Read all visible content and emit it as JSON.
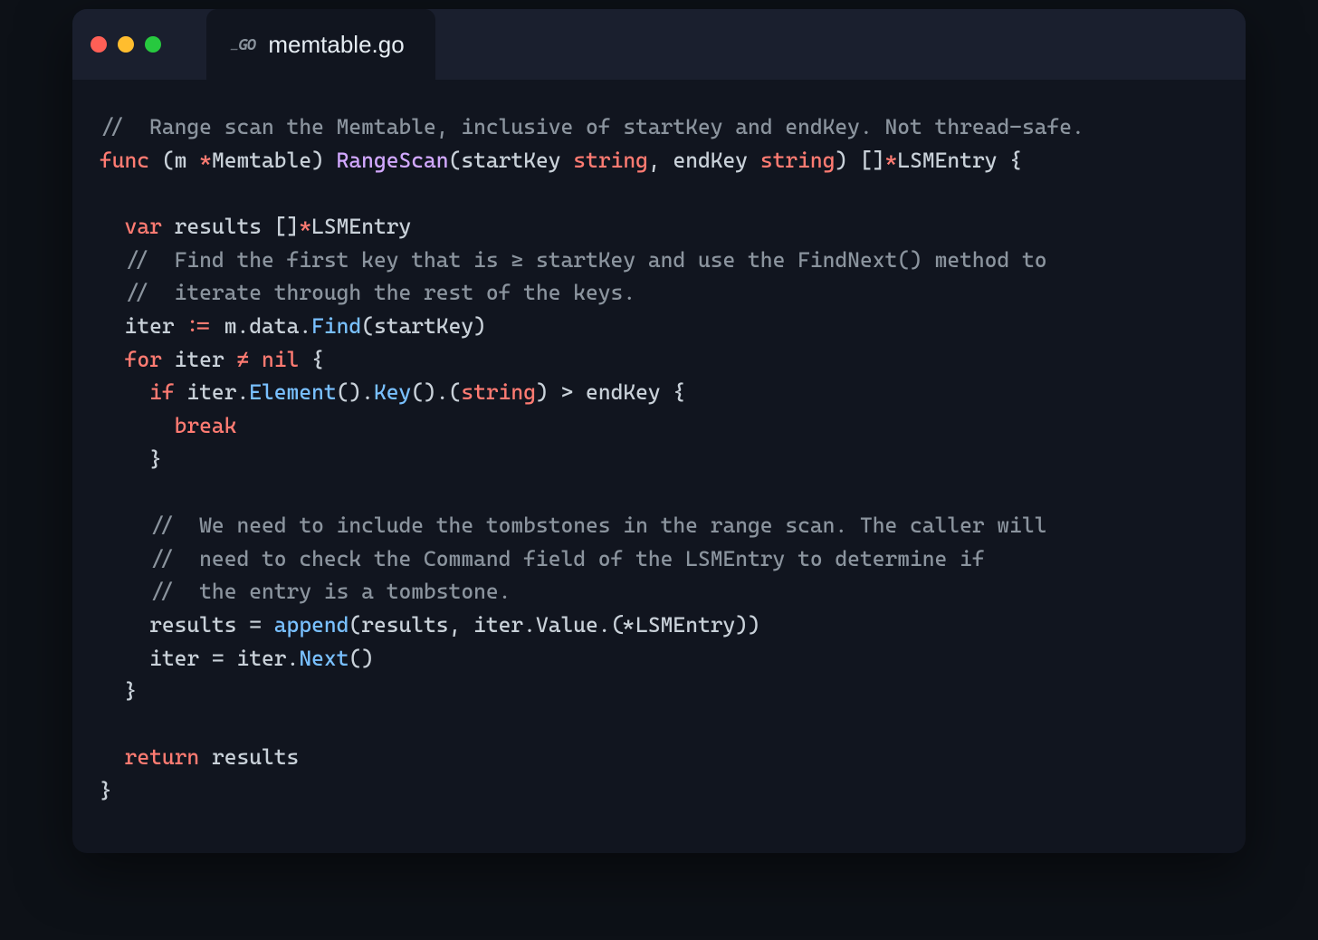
{
  "tab": {
    "filename": "memtable.go",
    "language_icon": "go"
  },
  "code": {
    "t01": "//  Range scan the Memtable, inclusive of startKey and endKey. Not thread-safe.",
    "t02_func": "func",
    "t02_recv_open": " (m ",
    "t02_star": "*",
    "t02_type": "Memtable",
    "t02_recv_close": ") ",
    "t02_name": "RangeScan",
    "t02_params_a": "(startKey ",
    "t02_ptype1": "string",
    "t02_params_b": ", endKey ",
    "t02_ptype2": "string",
    "t02_params_c": ") []",
    "t02_star2": "*",
    "t02_ret": "LSMEntry",
    "t02_brace": " {",
    "t03_var": "var",
    "t03_rest_a": " results []",
    "t03_star": "*",
    "t03_rest_b": "LSMEntry",
    "t04": "//  Find the first key that is ≥ startKey and use the FindNext() method to",
    "t05": "//  iterate through the rest of the keys.",
    "t06_a": "iter ",
    "t06_op": ":=",
    "t06_b": " m.data.",
    "t06_find": "Find",
    "t06_c": "(startKey)",
    "t07_for": "for",
    "t07_a": " iter ",
    "t07_neq": "≠",
    "t07_b": " ",
    "t07_nil": "nil",
    "t07_c": " {",
    "t08_if": "if",
    "t08_a": " iter.",
    "t08_elem": "Element",
    "t08_b": "().",
    "t08_key": "Key",
    "t08_c": "().(",
    "t08_str": "string",
    "t08_d": ") > endKey {",
    "t09_break": "break",
    "t10": "}",
    "t11": "//  We need to include the tombstones in the range scan. The caller will",
    "t12": "//  need to check the Command field of the LSMEntry to determine if",
    "t13": "//  the entry is a tombstone.",
    "t14_a": "results = ",
    "t14_append": "append",
    "t14_b": "(results, iter.Value.(",
    "t14_star": "*",
    "t14_type": "LSMEntry",
    "t14_c": "))",
    "t15_a": "iter = iter.",
    "t15_next": "Next",
    "t15_b": "()",
    "t16": "}",
    "t17_ret": "return",
    "t17_a": " results",
    "t18": "}"
  }
}
